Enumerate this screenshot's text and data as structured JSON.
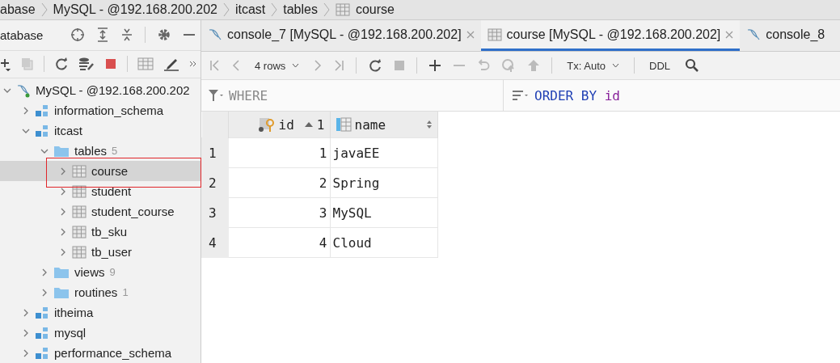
{
  "breadcrumbs": [
    {
      "label": "abase",
      "kind": "text"
    },
    {
      "label": "MySQL - @192.168.200.202",
      "kind": "text"
    },
    {
      "label": "itcast",
      "kind": "text"
    },
    {
      "label": "tables",
      "kind": "text"
    },
    {
      "label": "course",
      "kind": "table"
    }
  ],
  "panel": {
    "title": "atabase"
  },
  "tabs": [
    {
      "label": "console_7 [MySQL - @192.168.200.202]",
      "kind": "console",
      "selected": false,
      "closable": true
    },
    {
      "label": "course [MySQL - @192.168.200.202]",
      "kind": "table",
      "selected": true,
      "closable": true
    },
    {
      "label": "console_8",
      "kind": "console",
      "selected": false,
      "closable": false
    }
  ],
  "toolbar": {
    "rows": "4 rows",
    "tx": "Tx: Auto",
    "ddl": "DDL"
  },
  "filter": {
    "where": "WHERE",
    "order_keyword": "ORDER BY",
    "order_column": "id"
  },
  "tree": [
    {
      "label": "MySQL - @192.168.200.202",
      "kind": "connection",
      "expanded": true,
      "selected": false,
      "children": [
        {
          "label": "information_schema",
          "kind": "schema",
          "expanded": false,
          "selected": false
        },
        {
          "label": "itcast",
          "kind": "schema",
          "expanded": true,
          "selected": false,
          "children": [
            {
              "label": "tables",
              "count": "5",
              "kind": "folder",
              "expanded": true,
              "selected": false,
              "children": [
                {
                  "label": "course",
                  "kind": "table",
                  "expanded": false,
                  "selected": true
                },
                {
                  "label": "student",
                  "kind": "table",
                  "expanded": false,
                  "selected": false
                },
                {
                  "label": "student_course",
                  "kind": "table",
                  "expanded": false,
                  "selected": false
                },
                {
                  "label": "tb_sku",
                  "kind": "table",
                  "expanded": false,
                  "selected": false
                },
                {
                  "label": "tb_user",
                  "kind": "table",
                  "expanded": false,
                  "selected": false
                }
              ]
            },
            {
              "label": "views",
              "count": "9",
              "kind": "folder",
              "expanded": false,
              "selected": false
            },
            {
              "label": "routines",
              "count": "1",
              "kind": "folder",
              "expanded": false,
              "selected": false
            }
          ]
        },
        {
          "label": "itheima",
          "kind": "schema",
          "expanded": false,
          "selected": false
        },
        {
          "label": "mysql",
          "kind": "schema",
          "expanded": false,
          "selected": false
        },
        {
          "label": "performance_schema",
          "kind": "schema",
          "expanded": false,
          "selected": false
        }
      ]
    }
  ],
  "grid": {
    "columns": [
      {
        "label": "id",
        "kind": "key",
        "sort_order": "1"
      },
      {
        "label": "name",
        "kind": "plain"
      }
    ],
    "rows": [
      {
        "number": "1",
        "cells": [
          "1",
          "javaEE"
        ]
      },
      {
        "number": "2",
        "cells": [
          "2",
          "Spring"
        ]
      },
      {
        "number": "3",
        "cells": [
          "3",
          "MySQL"
        ]
      },
      {
        "number": "4",
        "cells": [
          "4",
          "Cloud"
        ]
      }
    ]
  }
}
